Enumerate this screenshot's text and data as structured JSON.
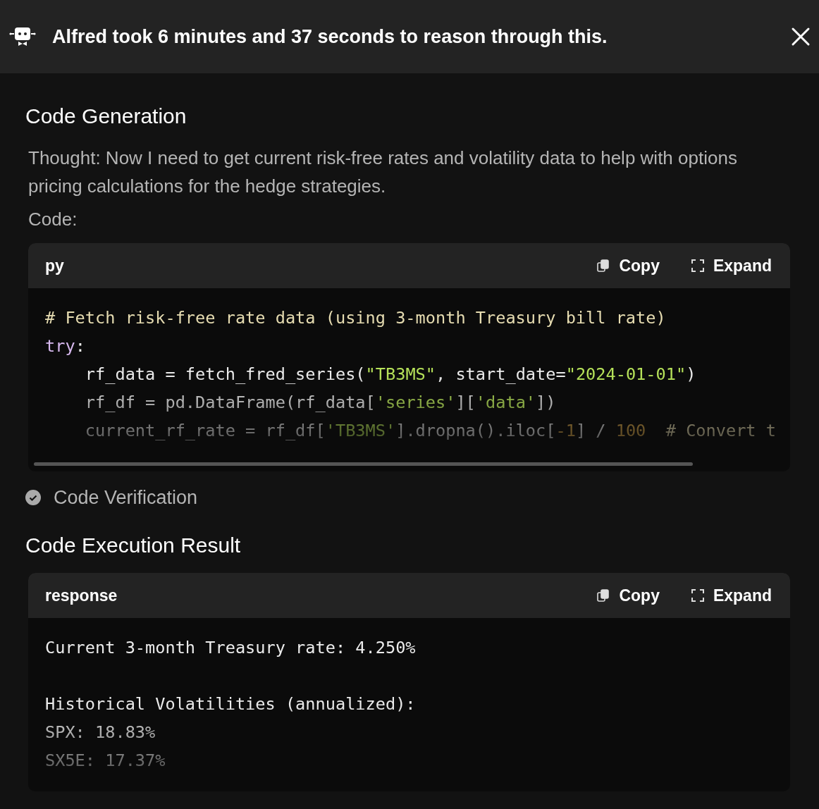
{
  "header": {
    "title": "Alfred took 6 minutes and 37 seconds to reason through this."
  },
  "sections": [
    {
      "kind": "heading",
      "text": "Code Generation"
    },
    {
      "kind": "paragraph",
      "text": "Thought: Now I need to get current risk-free rates and volatility data to help with options pricing calculations for the hedge strategies."
    },
    {
      "kind": "label",
      "text": "Code:"
    },
    {
      "kind": "code",
      "language": "py",
      "actions": [
        "Copy",
        "Expand"
      ],
      "scrollbar": true,
      "lines": [
        {
          "kind": "code",
          "tokens": [
            {
              "kind": "comment",
              "text": "# Fetch risk-free rate data (using 3-month Treasury bill rate)"
            }
          ]
        },
        {
          "kind": "code",
          "tokens": [
            {
              "kind": "keyword",
              "text": "try"
            },
            {
              "kind": "plain",
              "text": ":"
            }
          ]
        },
        {
          "kind": "code",
          "tokens": [
            {
              "kind": "plain",
              "text": "    rf_data = fetch_fred_series("
            },
            {
              "kind": "string",
              "text": "\"TB3MS\""
            },
            {
              "kind": "plain",
              "text": ", start_date="
            },
            {
              "kind": "string",
              "text": "\"2024-01-01\""
            },
            {
              "kind": "plain",
              "text": ")"
            }
          ]
        },
        {
          "kind": "code",
          "tokens": [
            {
              "kind": "plain",
              "text": "    rf_df = pd.DataFrame(rf_data["
            },
            {
              "kind": "string",
              "text": "'series'"
            },
            {
              "kind": "plain",
              "text": "]["
            },
            {
              "kind": "string",
              "text": "'data'"
            },
            {
              "kind": "plain",
              "text": "])"
            }
          ]
        },
        {
          "kind": "code",
          "tokens": [
            {
              "kind": "plain",
              "text": "    current_rf_rate = rf_df["
            },
            {
              "kind": "string",
              "text": "'TB3MS'"
            },
            {
              "kind": "plain",
              "text": "].dropna().iloc["
            },
            {
              "kind": "number",
              "text": "-1"
            },
            {
              "kind": "plain",
              "text": "] / "
            },
            {
              "kind": "number",
              "text": "100"
            },
            {
              "kind": "comment",
              "text": "  # Convert t"
            }
          ]
        }
      ]
    },
    {
      "kind": "step",
      "text": "Code Verification",
      "done": true
    },
    {
      "kind": "heading",
      "text": "Code Execution Result"
    },
    {
      "kind": "code",
      "language": "response",
      "actions": [
        "Copy",
        "Expand"
      ],
      "scrollbar": false,
      "lines": [
        {
          "kind": "code",
          "tokens": [
            {
              "kind": "plain",
              "text": "Current 3-month Treasury rate: 4.250%"
            }
          ]
        },
        {
          "kind": "blank"
        },
        {
          "kind": "code",
          "tokens": [
            {
              "kind": "plain",
              "text": "Historical Volatilities (annualized):"
            }
          ]
        },
        {
          "kind": "code",
          "tokens": [
            {
              "kind": "plain",
              "text": "SPX: 18.83%"
            }
          ]
        },
        {
          "kind": "code",
          "tokens": [
            {
              "kind": "plain",
              "text": "SX5E: 17.37%"
            }
          ]
        }
      ]
    }
  ]
}
